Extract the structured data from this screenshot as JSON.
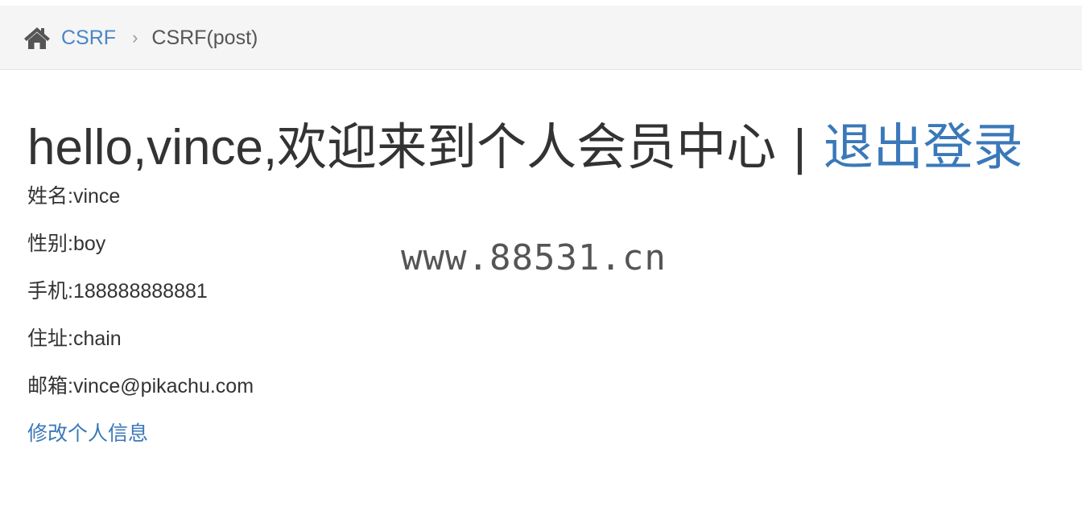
{
  "breadcrumb": {
    "home_icon": "home-icon",
    "parent": "CSRF",
    "separator": "›",
    "current": "CSRF(post)"
  },
  "header": {
    "greeting": "hello,vince,欢迎来到个人会员中心",
    "separator": "|",
    "logout": "退出登录"
  },
  "profile": [
    {
      "label": "姓名:vince"
    },
    {
      "label": "性别:boy"
    },
    {
      "label": "手机:188888888881"
    },
    {
      "label": "住址:chain"
    },
    {
      "label": "邮箱:vince@pikachu.com"
    }
  ],
  "edit_link": "修改个人信息",
  "watermark": "www.88531.cn",
  "colors": {
    "link": "#3a78b9",
    "text": "#333333",
    "breadcrumb_bg": "#f5f5f5"
  }
}
